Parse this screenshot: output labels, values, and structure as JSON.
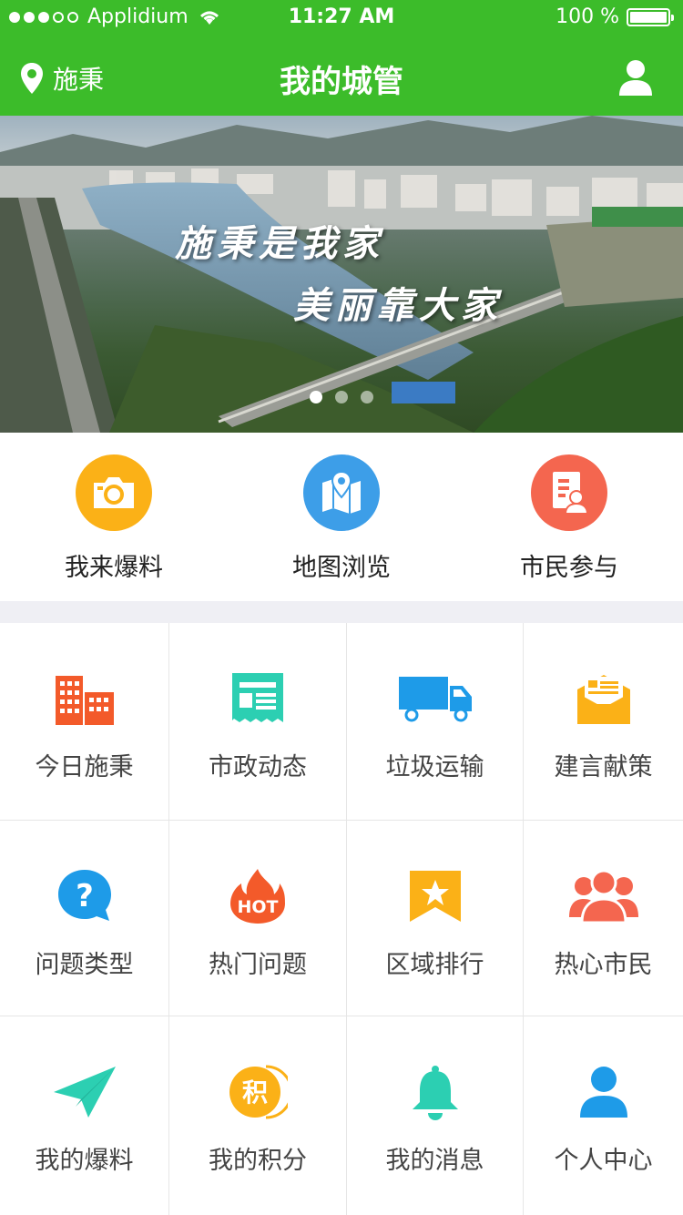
{
  "status_bar": {
    "carrier": "Applidium",
    "time": "11:27 AM",
    "battery": "100 %"
  },
  "nav": {
    "location": "施秉",
    "title": "我的城管"
  },
  "banner": {
    "line1": "施秉是我家",
    "line2": "美丽靠大家",
    "pages": 3,
    "active_page": 1
  },
  "quick_actions": [
    {
      "label": "我来爆料",
      "icon": "camera-icon",
      "color": "#fbb117"
    },
    {
      "label": "地图浏览",
      "icon": "map-pin-icon",
      "color": "#3d9ee8"
    },
    {
      "label": "市民参与",
      "icon": "form-user-icon",
      "color": "#f4664f"
    }
  ],
  "grid": [
    {
      "label": "今日施秉",
      "icon": "building-icon",
      "color": "#f35a2a"
    },
    {
      "label": "市政动态",
      "icon": "newspaper-icon",
      "color": "#2ccfb2"
    },
    {
      "label": "垃圾运输",
      "icon": "truck-icon",
      "color": "#1e9be8"
    },
    {
      "label": "建言献策",
      "icon": "mail-icon",
      "color": "#fbb117"
    },
    {
      "label": "问题类型",
      "icon": "question-icon",
      "color": "#1e9be8"
    },
    {
      "label": "热门问题",
      "icon": "hot-flame-icon",
      "color": "#f35a2a",
      "badge": "HOT"
    },
    {
      "label": "区域排行",
      "icon": "star-ribbon-icon",
      "color": "#fbb117"
    },
    {
      "label": "热心市民",
      "icon": "people-icon",
      "color": "#f4664f"
    },
    {
      "label": "我的爆料",
      "icon": "paper-plane-icon",
      "color": "#2ccfb2"
    },
    {
      "label": "我的积分",
      "icon": "points-icon",
      "color": "#fbb117",
      "badge": "积"
    },
    {
      "label": "我的消息",
      "icon": "bell-icon",
      "color": "#2ccfb2"
    },
    {
      "label": "个人中心",
      "icon": "person-icon",
      "color": "#1e9be8"
    }
  ]
}
